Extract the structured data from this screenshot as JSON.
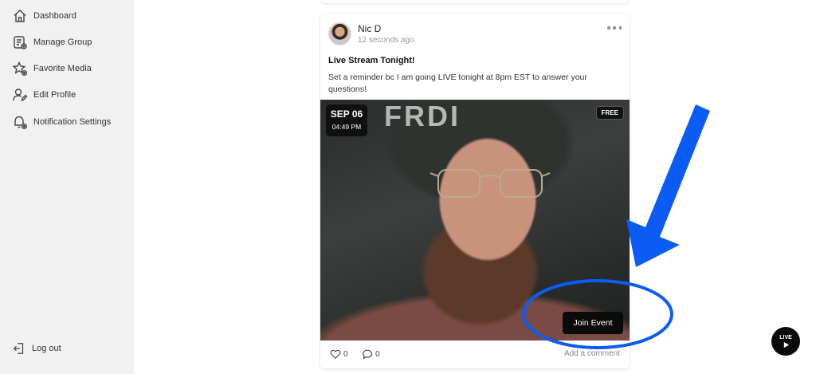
{
  "sidebar": {
    "items": [
      {
        "label": "Dashboard",
        "icon": "home-icon"
      },
      {
        "label": "Manage Group",
        "icon": "manage-group-icon"
      },
      {
        "label": "Favorite Media",
        "icon": "star-settings-icon"
      },
      {
        "label": "Edit Profile",
        "icon": "user-edit-icon"
      },
      {
        "label": "Notification Settings",
        "icon": "bell-settings-icon"
      }
    ],
    "logout_label": "Log out"
  },
  "post": {
    "author": "Nic D",
    "timestamp": "12 seconds ago",
    "title": "Live Stream Tonight!",
    "body": "Set a reminder bc I am going LIVE tonight at 8pm EST to answer your questions!",
    "media": {
      "date": "SEP 06",
      "time": "04:49 PM",
      "price_badge": "FREE",
      "join_label": "Join Event",
      "cap_text": "FRDI"
    },
    "likes": "0",
    "comments": "0",
    "add_comment_label": "Add a comment"
  },
  "live_button": {
    "label": "LIVE"
  },
  "annotation": {
    "color": "#0a5cf5"
  }
}
